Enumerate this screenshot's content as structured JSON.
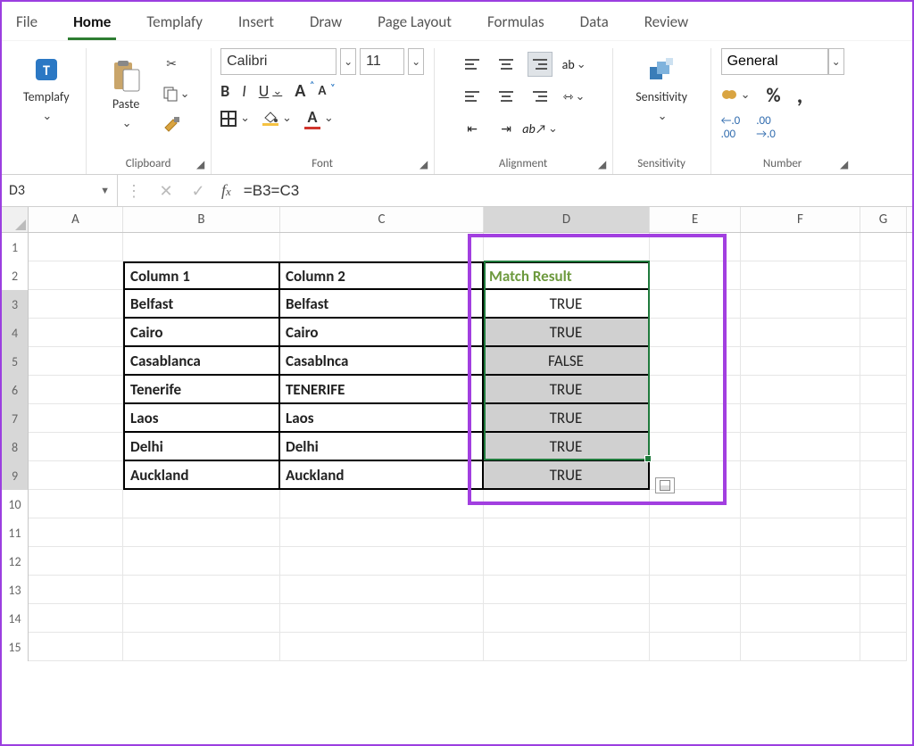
{
  "menu": {
    "items": [
      "File",
      "Home",
      "Templafy",
      "Insert",
      "Draw",
      "Page Layout",
      "Formulas",
      "Data",
      "Review"
    ],
    "active_index": 1
  },
  "ribbon": {
    "templafy_label": "Templafy",
    "clipboard": {
      "group": "Clipboard",
      "paste": "Paste"
    },
    "font": {
      "group": "Font",
      "font_name": "Calibri",
      "font_size": "11",
      "bold": "B",
      "italic": "I",
      "underline": "U"
    },
    "alignment": {
      "group": "Alignment",
      "wrap": "ab"
    },
    "sensitivity": {
      "group": "Sensitivity",
      "label": "Sensitivity"
    },
    "number": {
      "group": "Number",
      "format": "General",
      "percent": "%",
      "comma": ","
    }
  },
  "namebox": "D3",
  "formula": "=B3=C3",
  "columns": [
    "A",
    "B",
    "C",
    "D",
    "E",
    "F",
    "G"
  ],
  "selected_column": "D",
  "selected_rows": [
    3,
    4,
    5,
    6,
    7,
    8,
    9
  ],
  "row_labels": [
    "1",
    "2",
    "3",
    "4",
    "5",
    "6",
    "7",
    "8",
    "9",
    "10",
    "11",
    "12",
    "13",
    "14",
    "15"
  ],
  "table": {
    "headers": {
      "c1": "Column 1",
      "c2": "Column 2",
      "c3": "Match Result"
    },
    "rows": [
      {
        "b": "Belfast",
        "c": "Belfast",
        "d": "TRUE"
      },
      {
        "b": "Cairo",
        "c": "Cairo",
        "d": "TRUE"
      },
      {
        "b": "Casablanca",
        "c": "Casablnca",
        "d": "FALSE"
      },
      {
        "b": "Tenerife",
        "c": "TENERIFE",
        "d": "TRUE"
      },
      {
        "b": "Laos",
        "c": "Laos",
        "d": "TRUE"
      },
      {
        "b": "Delhi",
        "c": "Delhi",
        "d": "TRUE"
      },
      {
        "b": "Auckland",
        "c": "Auckland",
        "d": "TRUE"
      }
    ]
  },
  "chart_data": {
    "type": "table",
    "title": "Match Result",
    "columns": [
      "Column 1",
      "Column 2",
      "Match Result"
    ],
    "rows": [
      [
        "Belfast",
        "Belfast",
        "TRUE"
      ],
      [
        "Cairo",
        "Cairo",
        "TRUE"
      ],
      [
        "Casablanca",
        "Casablnca",
        "FALSE"
      ],
      [
        "Tenerife",
        "TENERIFE",
        "TRUE"
      ],
      [
        "Laos",
        "Laos",
        "TRUE"
      ],
      [
        "Delhi",
        "Delhi",
        "TRUE"
      ],
      [
        "Auckland",
        "Auckland",
        "TRUE"
      ]
    ]
  }
}
